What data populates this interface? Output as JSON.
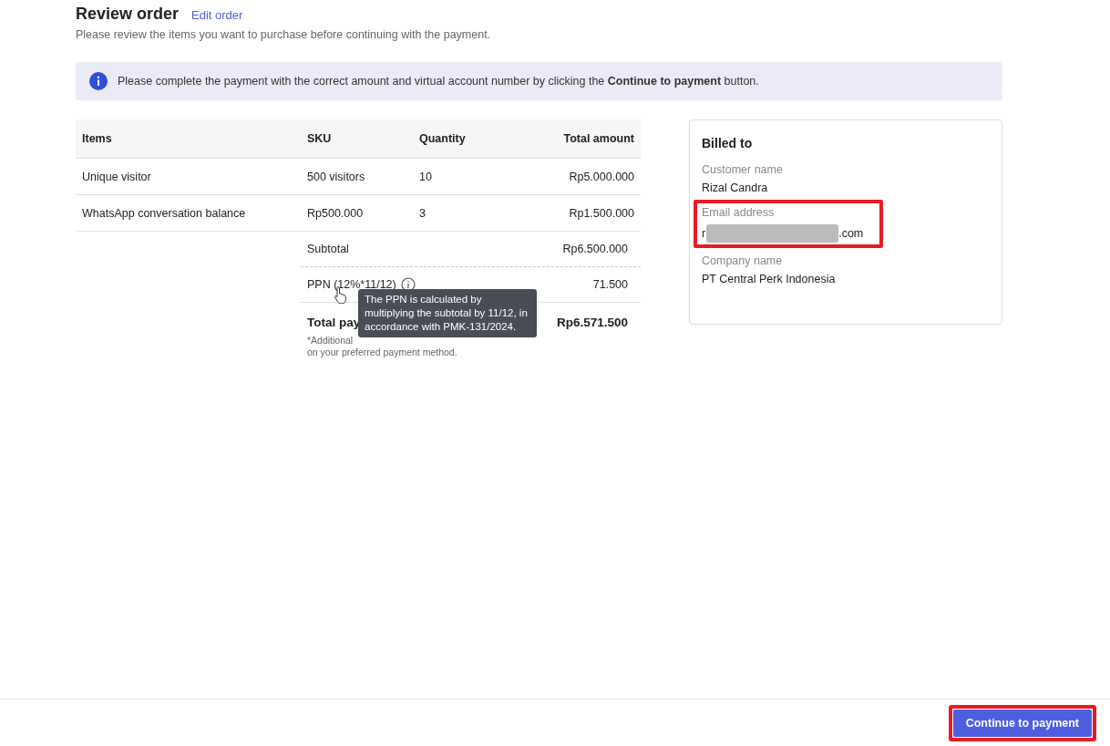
{
  "header": {
    "title": "Review order",
    "edit_link": "Edit order",
    "subtitle": "Please review the items you want to purchase before continuing with the payment."
  },
  "notice": {
    "text": "Please complete the payment with the correct amount and virtual account number by clicking the **Continue to payment** button."
  },
  "table": {
    "columns": [
      "Items",
      "SKU",
      "Quantity",
      "Total amount"
    ],
    "rows": [
      {
        "item": "Unique visitor",
        "sku": "500 visitors",
        "quantity": "10",
        "total": "Rp5.000.000"
      },
      {
        "item": "WhatsApp conversation balance",
        "sku": "Rp500.000",
        "quantity": "3",
        "total": "Rp1.500.000"
      }
    ],
    "subtotal": {
      "label": "Subtotal",
      "value": "Rp6.500.000"
    },
    "tax": {
      "label": "PPN (12%*11/12)",
      "value": "71.500"
    },
    "total": {
      "label": "Total pay",
      "value": "Rp6.571.500"
    },
    "note_lines": [
      "*Additional",
      "on your preferred payment method."
    ]
  },
  "tooltip": {
    "text": "The PPN is calculated by multiplying the subtotal by 11/12, in accordance with PMK-131/2024."
  },
  "billing": {
    "title": "Billed to",
    "fields": [
      {
        "label": "Customer name",
        "value": "Rizal Candra",
        "highlighted": false
      },
      {
        "label": "Email address",
        "value_start": "r",
        "value_end": ".com",
        "redacted": true,
        "highlighted": true
      },
      {
        "label": "Company name",
        "value": "PT Central Perk Indonesia",
        "highlighted": false
      }
    ]
  },
  "footer": {
    "button": "Continue to payment",
    "highlighted": true
  }
}
